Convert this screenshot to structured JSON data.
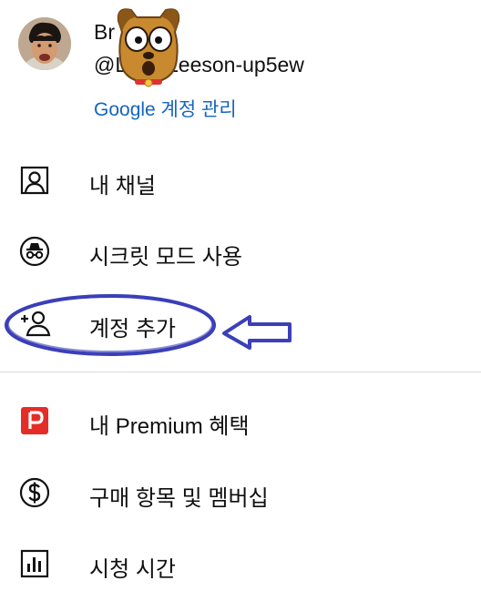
{
  "account": {
    "name": "Br      ee",
    "handle": "@L       Leeson-up5ew",
    "manage_link": "Google 계정 관리"
  },
  "menu": {
    "primary": [
      {
        "label": "내 채널",
        "icon": "person-box-icon"
      },
      {
        "label": "시크릿 모드 사용",
        "icon": "incognito-icon"
      },
      {
        "label": "계정 추가",
        "icon": "add-person-icon"
      }
    ],
    "secondary": [
      {
        "label": "내 Premium 혜택",
        "icon": "premium-p-icon"
      },
      {
        "label": "구매 항목 및 멤버십",
        "icon": "dollar-circle-icon"
      },
      {
        "label": "시청 시간",
        "icon": "bar-chart-icon"
      }
    ]
  },
  "colors": {
    "link": "#1565c0",
    "premium": "#e52d27",
    "annotation": "#3b3fb8"
  }
}
